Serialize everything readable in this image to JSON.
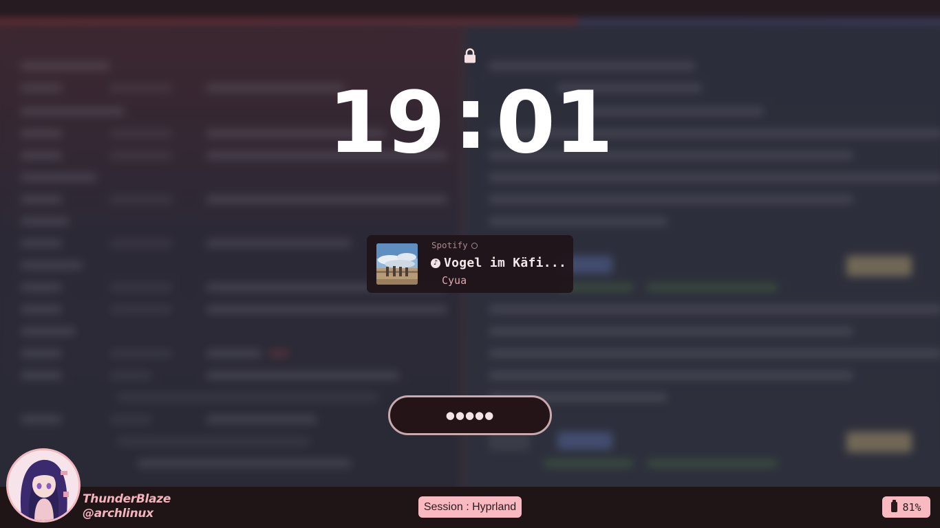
{
  "clock": {
    "hours": "19",
    "separator": ":",
    "minutes": "01"
  },
  "media": {
    "player": "Spotify",
    "title": "Vogel im Käfi...",
    "artist": "Cyua",
    "music_icon": "♪"
  },
  "password": {
    "masked_value": "●●●●●"
  },
  "user": {
    "username": "ThunderBlaze",
    "host": "@archlinux"
  },
  "session": {
    "label": "Session : Hyprland"
  },
  "battery": {
    "percent": "81%"
  },
  "colors": {
    "accent": "#f8b9c0",
    "bar": "#1f1416",
    "username": "#f3b4bd"
  },
  "icons": {
    "lock": "lock-icon",
    "player": "spotify-icon",
    "music": "music-note-icon",
    "battery": "battery-icon"
  }
}
